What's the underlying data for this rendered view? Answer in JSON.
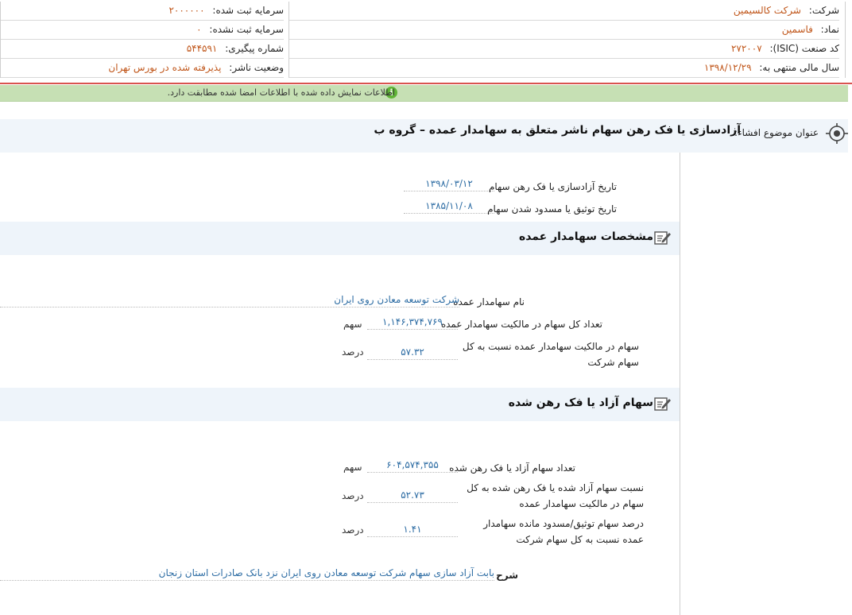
{
  "header": {
    "company_label": "شرکت:",
    "company_value": "شرکت کالسیمین",
    "symbol_label": "نماد:",
    "symbol_value": "فاسمین",
    "isic_label": "کد صنعت (ISIC):",
    "isic_value": "۲۷۲۰۰۷",
    "fiscal_label": "سال مالی منتهی به:",
    "fiscal_value": "۱۳۹۸/۱۲/۲۹",
    "registered_capital_label": "سرمایه ثبت شده:",
    "registered_capital_value": "۲۰۰۰۰۰۰",
    "unregistered_capital_label": "سرمایه ثبت نشده:",
    "unregistered_capital_value": "۰",
    "tracking_label": "شماره پیگیری:",
    "tracking_value": "۵۴۴۵۹۱",
    "publisher_status_label": "وضعیت ناشر:",
    "publisher_status_value": "پذیرفته شده در بورس تهران"
  },
  "alert": {
    "text": "اطلاعات نمایش داده شده با اطلاعات امضا شده مطابقت دارد."
  },
  "subject": {
    "label": "عنوان موضوع افشاء:",
    "title": "آزادسازی یا فک رهن سهام ناشر متعلق به سهامدار عمده – گروه ب"
  },
  "dates": {
    "release_label": "تاریخ آزادسازی یا فک رهن سهام",
    "release_value": "۱۳۹۸/۰۳/۱۲",
    "pledge_label": "تاریخ توثیق یا مسدود شدن سهام",
    "pledge_value": "۱۳۸۵/۱۱/۰۸"
  },
  "shareholder": {
    "section_title": "مشخصات سهامدار عمده",
    "name_label": "نام سهامدار عمده",
    "name_value": "شرکت توسعه معادن روی ایران",
    "total_label": "تعداد کل سهام در مالکیت سهامدار عمده",
    "total_value": "۱,۱۴۶,۳۷۴,۷۶۹",
    "total_unit": "سهم",
    "ratio_label": "سهام در مالکیت سهامدار عمده نسبت به کل سهام شرکت",
    "ratio_value": "۵۷.۳۲",
    "ratio_unit": "درصد"
  },
  "released": {
    "section_title": "سهام آزاد یا فک رهن شده",
    "count_label": "تعداد سهام آزاد یا فک رهن شده",
    "count_value": "۶۰۴,۵۷۴,۳۵۵",
    "count_unit": "سهم",
    "ratio_label": "نسبت سهام آزاد شده یا فک رهن شده به کل سهام در مالکیت سهامدار عمده",
    "ratio_value": "۵۲.۷۳",
    "ratio_unit": "درصد",
    "remaining_label": "درصد سهام توثیق/مسدود مانده سهامدار عمده نسبت به کل سهام شرکت",
    "remaining_value": "۱.۴۱",
    "remaining_unit": "درصد"
  },
  "description": {
    "label": "شرح",
    "value": "بابت آزاد سازی سهام شرکت توسعه معادن روی ایران نزد بانک صادرات استان زنجان"
  }
}
